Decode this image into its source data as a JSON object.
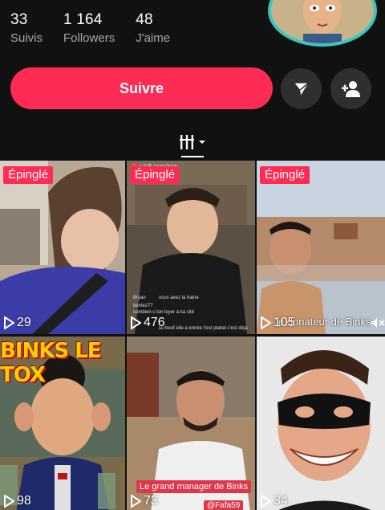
{
  "stats": [
    {
      "value": "33",
      "label": "Suivis"
    },
    {
      "value": "1 164",
      "label": "Followers"
    },
    {
      "value": "48",
      "label": "J'aime"
    }
  ],
  "follow_button": {
    "label": "Suivre"
  },
  "icons": {
    "share": "send-icon",
    "add_friend": "add-user-icon",
    "grid_tab": "grid-icon",
    "views": "play-icon",
    "mute": "mute-icon"
  },
  "colors": {
    "accent": "#fe2c55",
    "background": "#111111",
    "avatar_ring": "#36c8c0"
  },
  "videos": [
    {
      "pinned": "Épinglé",
      "views": "29"
    },
    {
      "pinned": "Épinglé",
      "views": "476",
      "live_label": "🔴 LIVE populaire",
      "comment_user": "Bryan",
      "comment_text": "vous avez la haine",
      "comment_line2_user": "bentez77",
      "comment_line2": "combien c ton loyer a ka cité",
      "comment_line3": "la meuf elle a ennée t'est plakel c'est déjà"
    },
    {
      "pinned": "Épinglé",
      "views": "105",
      "caption": "le donateur de Binks"
    },
    {
      "banner": "BINKS LE TOX",
      "views": "98"
    },
    {
      "views": "73",
      "caption": "Le grand manager de Binks",
      "handle": "@Fafa59"
    },
    {
      "views": "34"
    }
  ]
}
